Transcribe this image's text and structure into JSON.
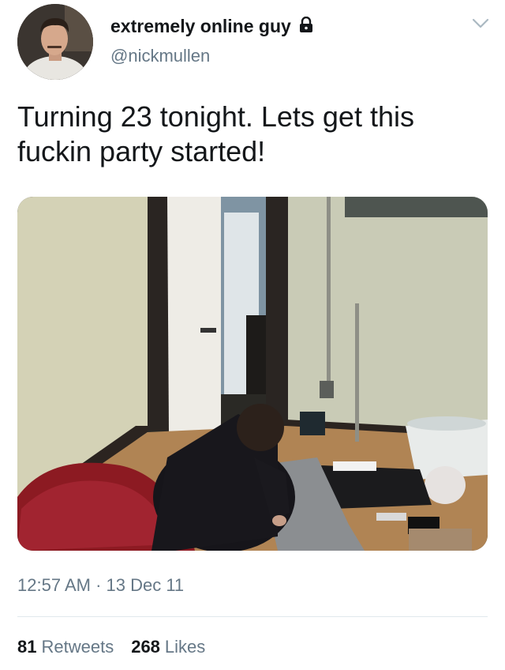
{
  "author": {
    "display_name": "extremely online guy",
    "handle": "@nickmullen",
    "avatar_icon": "profile-photo",
    "protected_icon": "lock-icon"
  },
  "tweet": {
    "text": "Turning 23 tonight. Lets get this\nfuckin party started!",
    "media_description": "photo",
    "timestamp": "12:57 AM · 13 Dec 11"
  },
  "stats": {
    "retweets_count": "81",
    "retweets_label": "Retweets",
    "likes_count": "268",
    "likes_label": "Likes"
  },
  "colors": {
    "primary_text": "#14171a",
    "secondary_text": "#657786",
    "divider": "#e1e8ed"
  }
}
